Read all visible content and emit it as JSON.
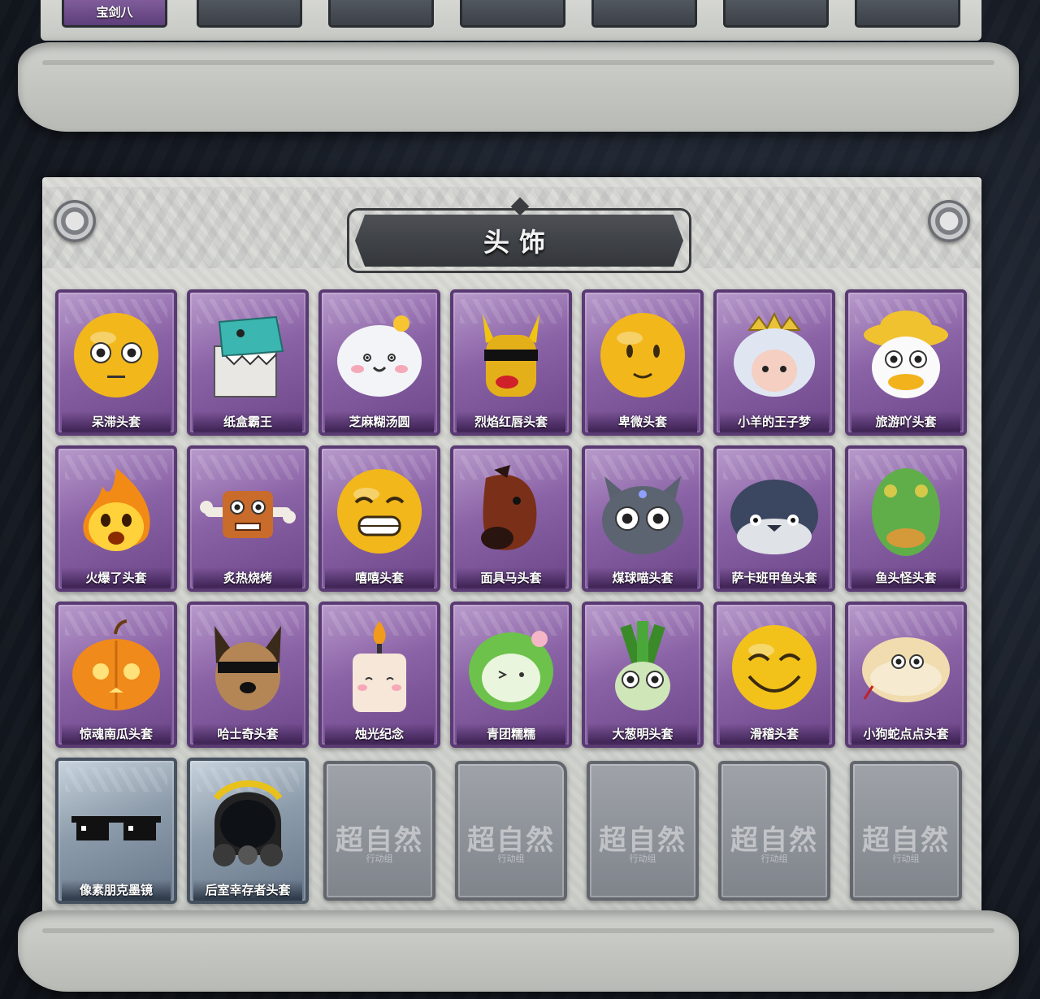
{
  "top_panel": {
    "visible_label": "宝剑八",
    "empty_slot_count": 6
  },
  "section": {
    "title": "头饰"
  },
  "items": [
    {
      "name": "呆滞头套",
      "rarity": "purple",
      "icon": "stunned-face-mask"
    },
    {
      "name": "纸盒霸王",
      "rarity": "purple",
      "icon": "cardboard-dinosaur"
    },
    {
      "name": "芝麻糊汤圆",
      "rarity": "purple",
      "icon": "rice-ball-face"
    },
    {
      "name": "烈焰红唇头套",
      "rarity": "purple",
      "icon": "yellow-mouse-sunglasses"
    },
    {
      "name": "卑微头套",
      "rarity": "purple",
      "icon": "humble-face-mask"
    },
    {
      "name": "小羊的王子梦",
      "rarity": "purple",
      "icon": "sheep-crown"
    },
    {
      "name": "旅游吖头套",
      "rarity": "purple",
      "icon": "duck-hat"
    },
    {
      "name": "火爆了头套",
      "rarity": "purple",
      "icon": "fire-face"
    },
    {
      "name": "炙热烧烤",
      "rarity": "purple",
      "icon": "bbq-meat"
    },
    {
      "name": "嘻嘻头套",
      "rarity": "purple",
      "icon": "grin-face"
    },
    {
      "name": "面具马头套",
      "rarity": "purple",
      "icon": "horse-mask"
    },
    {
      "name": "煤球喵头套",
      "rarity": "purple",
      "icon": "grey-cat"
    },
    {
      "name": "萨卡班甲鱼头套",
      "rarity": "purple",
      "icon": "fish-head"
    },
    {
      "name": "鱼头怪头套",
      "rarity": "purple",
      "icon": "green-fish-monster"
    },
    {
      "name": "惊魂南瓜头套",
      "rarity": "purple",
      "icon": "pumpkin"
    },
    {
      "name": "哈士奇头套",
      "rarity": "purple",
      "icon": "dog-sunglasses"
    },
    {
      "name": "烛光纪念",
      "rarity": "purple",
      "icon": "candle-face"
    },
    {
      "name": "青团糯糯",
      "rarity": "purple",
      "icon": "green-dumpling"
    },
    {
      "name": "大葱明头套",
      "rarity": "purple",
      "icon": "green-onion"
    },
    {
      "name": "滑稽头套",
      "rarity": "purple",
      "icon": "funny-face"
    },
    {
      "name": "小狗蛇点点头套",
      "rarity": "purple",
      "icon": "snake-head"
    },
    {
      "name": "像素朋克墨镜",
      "rarity": "blue",
      "icon": "pixel-sunglasses"
    },
    {
      "name": "后室幸存者头套",
      "rarity": "blue",
      "icon": "gas-mask-helmet"
    }
  ],
  "empty_slot": {
    "logo": "超自然",
    "subtitle": "行动组"
  },
  "colors": {
    "purple_card": "#8a62a6",
    "blue_card": "#8d9cab",
    "panel": "#d4d6d2",
    "banner": "#3f4247"
  }
}
